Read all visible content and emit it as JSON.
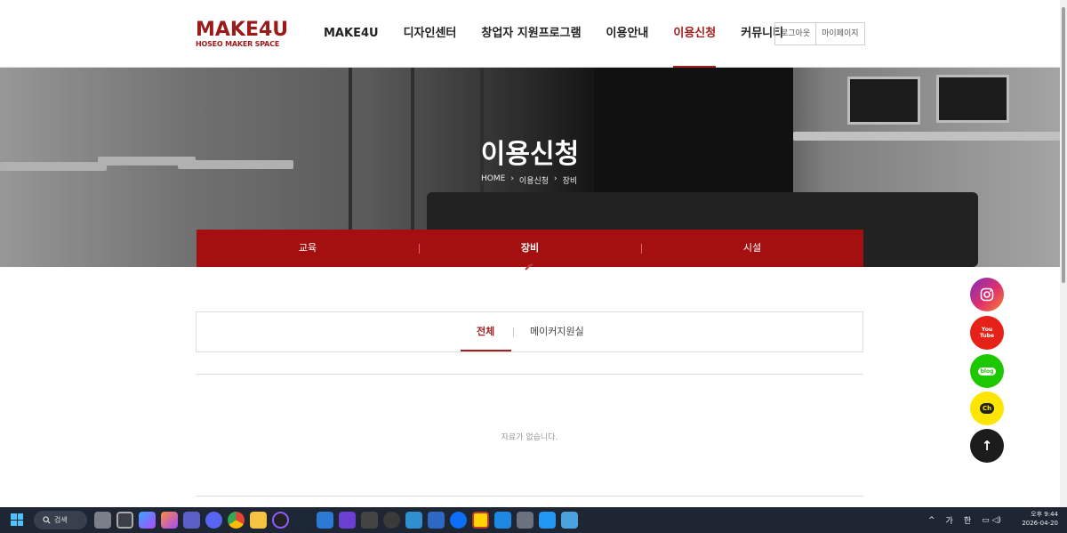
{
  "header": {
    "logo": {
      "main": "MAKE4U",
      "sub": "HOSEO MAKER SPACE"
    },
    "nav": [
      {
        "label": "MAKE4U",
        "active": false
      },
      {
        "label": "디자인센터",
        "active": false
      },
      {
        "label": "창업자 지원프로그램",
        "active": false
      },
      {
        "label": "이용안내",
        "active": false
      },
      {
        "label": "이용신청",
        "active": true
      },
      {
        "label": "커뮤니티",
        "active": false
      }
    ],
    "auth": {
      "logout": "로그아웃",
      "mypage": "마이페이지"
    }
  },
  "hero": {
    "title": "이용신청",
    "breadcrumb": [
      "HOME",
      "이용신청",
      "장비"
    ]
  },
  "subtabs": [
    {
      "label": "교육",
      "active": false
    },
    {
      "label": "장비",
      "active": true
    },
    {
      "label": "시설",
      "active": false
    }
  ],
  "filter_tabs": [
    {
      "label": "전체",
      "active": true
    },
    {
      "label": "메이커지원실",
      "active": false
    }
  ],
  "list": {
    "empty_message": "자료가 없습니다."
  },
  "social": [
    {
      "name": "instagram",
      "label": ""
    },
    {
      "name": "youtube",
      "label": "You Tube"
    },
    {
      "name": "blog",
      "label": "blog"
    },
    {
      "name": "kakao-channel",
      "label": "Ch"
    },
    {
      "name": "scroll-top",
      "label": "↑"
    }
  ],
  "taskbar": {
    "search_label": "검색",
    "ime": [
      "가",
      "한"
    ],
    "clock": {
      "time": "오후 9:44",
      "date": "2026-04-20"
    }
  },
  "colors": {
    "brand": "#a3100f",
    "accent_text": "#a01f1f"
  }
}
